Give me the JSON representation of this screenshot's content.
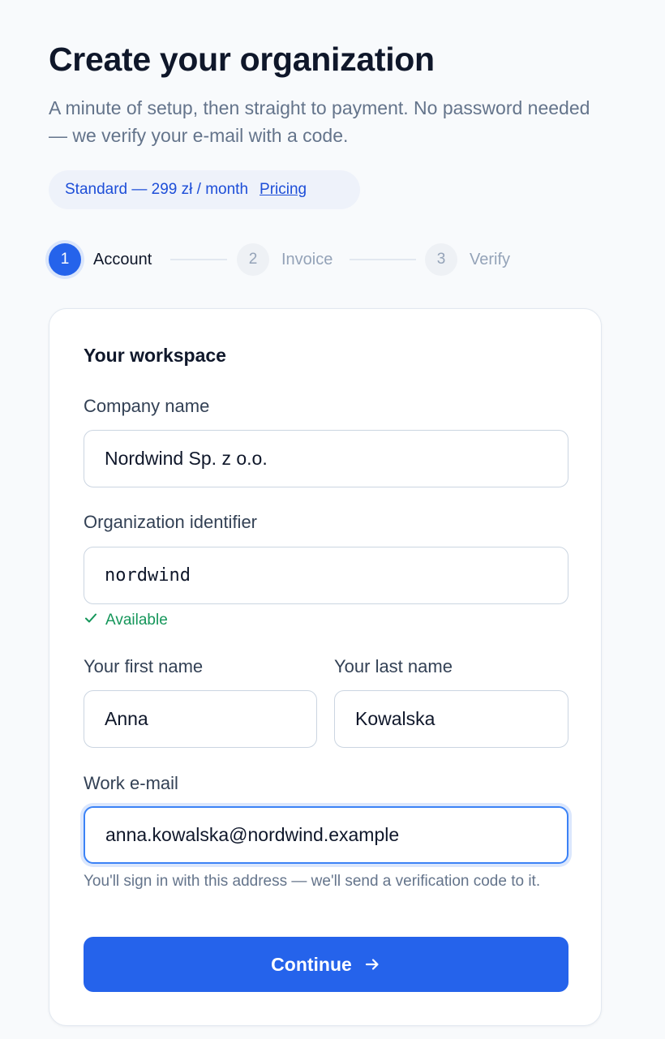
{
  "header": {
    "title": "Create your organization",
    "subtitle": "A minute of setup, then straight to payment. No password needed — we verify your e-mail with a code."
  },
  "plan": {
    "text": "Standard — 299 zł / month",
    "link_label": "Pricing"
  },
  "steps": [
    {
      "number": "1",
      "label": "Account",
      "state": "active"
    },
    {
      "number": "2",
      "label": "Invoice",
      "state": "pending"
    },
    {
      "number": "3",
      "label": "Verify",
      "state": "pending"
    }
  ],
  "form": {
    "heading": "Your workspace",
    "company": {
      "label": "Company name",
      "value": "Nordwind Sp. z o.o."
    },
    "identifier": {
      "label": "Organization identifier",
      "value": "nordwind",
      "status": "Available"
    },
    "first_name": {
      "label": "Your first name",
      "value": "Anna"
    },
    "last_name": {
      "label": "Your last name",
      "value": "Kowalska"
    },
    "email": {
      "label": "Work e-mail",
      "value": "anna.kowalska@nordwind.example",
      "hint": "You'll sign in with this address — we'll send a verification code to it."
    },
    "submit_label": "Continue"
  },
  "colors": {
    "accent": "#2563eb",
    "success": "#15965a",
    "muted": "#64748b",
    "background": "#f8fafc"
  },
  "icons": {
    "available": "check-icon",
    "continue": "arrow-right-icon"
  }
}
